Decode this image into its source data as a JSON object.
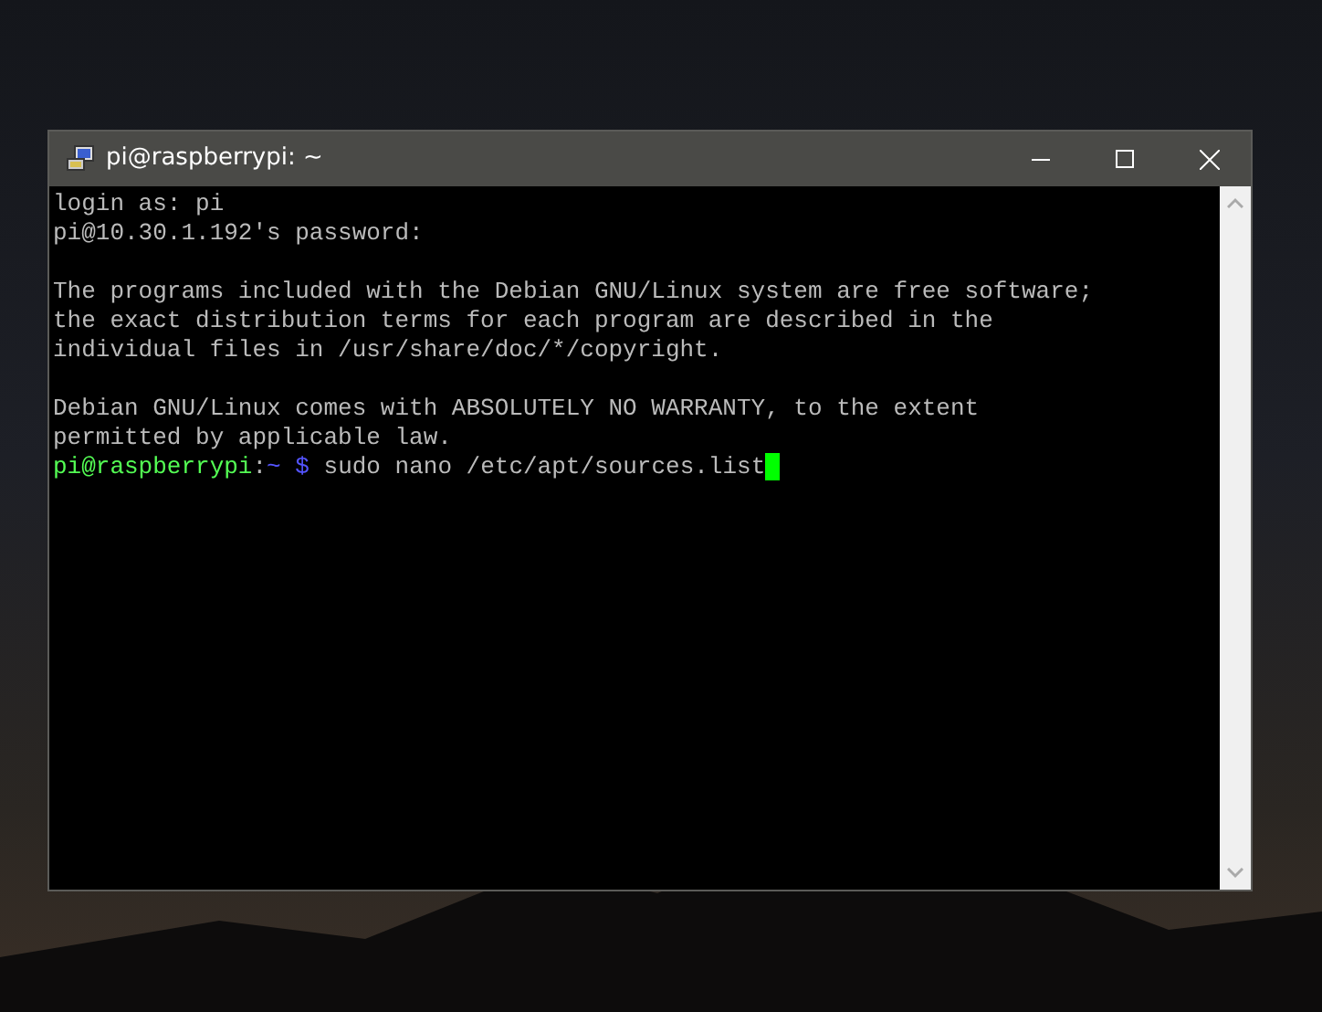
{
  "window": {
    "title": "pi@raspberrypi: ~"
  },
  "terminal": {
    "lines": [
      {
        "kind": "text",
        "text": "login as: pi"
      },
      {
        "kind": "text",
        "text": "pi@10.30.1.192's password:"
      },
      {
        "kind": "blank"
      },
      {
        "kind": "text",
        "text": "The programs included with the Debian GNU/Linux system are free software;"
      },
      {
        "kind": "text",
        "text": "the exact distribution terms for each program are described in the"
      },
      {
        "kind": "text",
        "text": "individual files in /usr/share/doc/*/copyright."
      },
      {
        "kind": "blank"
      },
      {
        "kind": "text",
        "text": "Debian GNU/Linux comes with ABSOLUTELY NO WARRANTY, to the extent"
      },
      {
        "kind": "text",
        "text": "permitted by applicable law."
      },
      {
        "kind": "prompt",
        "user": "pi@raspberrypi",
        "separator": ":",
        "path": "~",
        "symbol": "$",
        "command": "sudo nano /etc/apt/sources.list",
        "cursor": true
      }
    ]
  }
}
